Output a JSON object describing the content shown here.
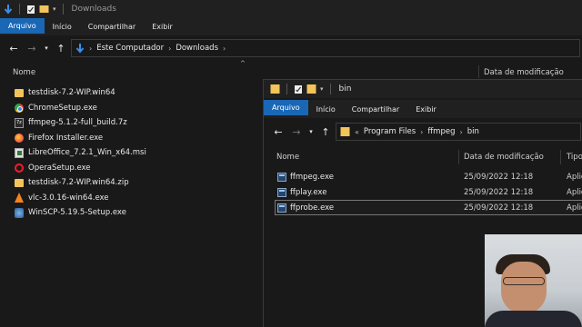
{
  "back_window": {
    "title": "Downloads",
    "ribbon_tabs": [
      "Arquivo",
      "Início",
      "Compartilhar",
      "Exibir"
    ],
    "breadcrumb": [
      "Este Computador",
      "Downloads"
    ],
    "columns": {
      "name": "Nome",
      "date": "Data de modificação"
    },
    "files": [
      {
        "name": "testdisk-7.2-WIP.win64",
        "icon": "folder-icon"
      },
      {
        "name": "ChromeSetup.exe",
        "icon": "chrome-icon"
      },
      {
        "name": "ffmpeg-5.1.2-full_build.7z",
        "icon": "7zip-icon"
      },
      {
        "name": "Firefox Installer.exe",
        "icon": "firefox-icon"
      },
      {
        "name": "LibreOffice_7.2.1_Win_x64.msi",
        "icon": "msi-icon"
      },
      {
        "name": "OperaSetup.exe",
        "icon": "opera-icon"
      },
      {
        "name": "testdisk-7.2-WIP.win64.zip",
        "icon": "zip-folder-icon"
      },
      {
        "name": "vlc-3.0.16-win64.exe",
        "icon": "vlc-icon"
      },
      {
        "name": "WinSCP-5.19.5-Setup.exe",
        "icon": "winscp-icon"
      }
    ]
  },
  "front_window": {
    "title": "bin",
    "ribbon_tabs": [
      "Arquivo",
      "Início",
      "Compartilhar",
      "Exibir"
    ],
    "breadcrumb_overflow": "«",
    "breadcrumb": [
      "Program Files",
      "ffmpeg",
      "bin"
    ],
    "columns": {
      "name": "Nome",
      "date": "Data de modificação",
      "type": "Tipo"
    },
    "files": [
      {
        "name": "ffmpeg.exe",
        "date": "25/09/2022 12:18",
        "type": "Aplic"
      },
      {
        "name": "ffplay.exe",
        "date": "25/09/2022 12:18",
        "type": "Aplic"
      },
      {
        "name": "ffprobe.exe",
        "date": "25/09/2022 12:18",
        "type": "Aplic"
      }
    ]
  },
  "colors": {
    "accent": "#1a67b5",
    "folder": "#f2c45a",
    "background": "#191919"
  }
}
